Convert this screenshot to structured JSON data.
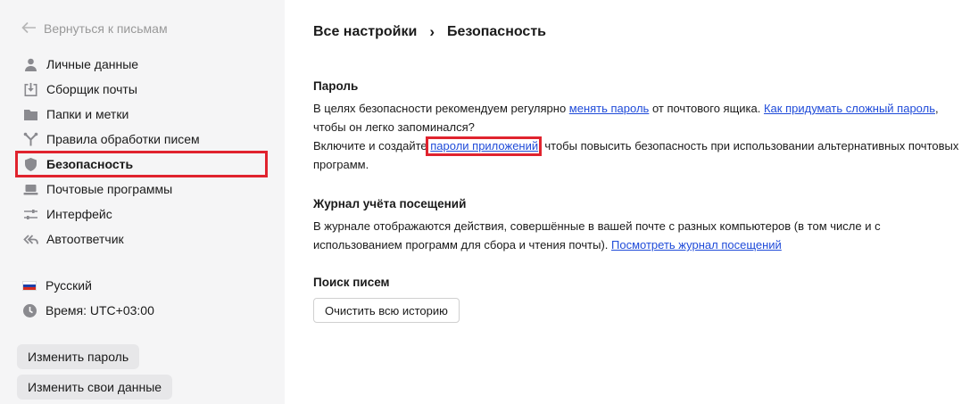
{
  "sidebar": {
    "back_label": "Вернуться к письмам",
    "items": [
      {
        "label": "Личные данные",
        "icon": "person-icon"
      },
      {
        "label": "Сборщик почты",
        "icon": "inbox-download-icon"
      },
      {
        "label": "Папки и метки",
        "icon": "folder-icon"
      },
      {
        "label": "Правила обработки писем",
        "icon": "rules-fork-icon"
      },
      {
        "label": "Безопасность",
        "icon": "shield-icon",
        "active": true
      },
      {
        "label": "Почтовые программы",
        "icon": "laptop-icon"
      },
      {
        "label": "Интерфейс",
        "icon": "sliders-icon"
      },
      {
        "label": "Автоответчик",
        "icon": "reply-all-icon"
      }
    ],
    "language": "Русский",
    "timezone": "Время: UTC+03:00",
    "change_password_button": "Изменить пароль",
    "change_data_button": "Изменить свои данные"
  },
  "header": {
    "crumb_all": "Все настройки",
    "separator": "›",
    "crumb_current": "Безопасность"
  },
  "password": {
    "title": "Пароль",
    "p1_before": "В целях безопасности рекомендуем регулярно ",
    "p1_link1": "менять пароль",
    "p1_middle": " от почтового ящика. ",
    "p1_link2": "Как придумать сложный пароль",
    "p1_after": ", чтобы он легко запоминался?",
    "p2_before": "Включите и создайте ",
    "p2_link": "пароли приложений",
    "p2_after": ", чтобы повысить безопасность при использовании альтернативных почтовых программ."
  },
  "journal": {
    "title": "Журнал учёта посещений",
    "text": "В журнале отображаются действия, совершённые в вашей почте с разных компьютеров (в том числе и с использованием программ для сбора и чтения почты). ",
    "link": "Посмотреть журнал посещений"
  },
  "search": {
    "title": "Поиск писем",
    "clear_button": "Очистить всю историю"
  },
  "colors": {
    "sidebar_bg": "#f5f5f6",
    "link": "#1f4bd9",
    "highlight": "#e0232e",
    "flag": [
      "#ffffff",
      "#1c3fa8",
      "#d52b1e"
    ]
  }
}
